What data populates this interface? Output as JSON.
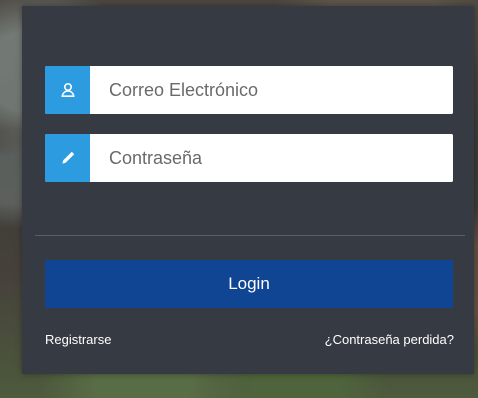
{
  "login_form": {
    "email": {
      "placeholder": "Correo Electrónico",
      "value": "",
      "icon": "user-icon"
    },
    "password": {
      "placeholder": "Contraseña",
      "value": "",
      "icon": "pencil-icon"
    },
    "login_label": "Login",
    "register_label": "Registrarse",
    "lost_password_label": "¿Contraseña perdida?"
  },
  "colors": {
    "panel": "#363a43",
    "icon_background": "#2d9be0",
    "login_button": "#0f4592",
    "divider": "#5a5e68"
  }
}
